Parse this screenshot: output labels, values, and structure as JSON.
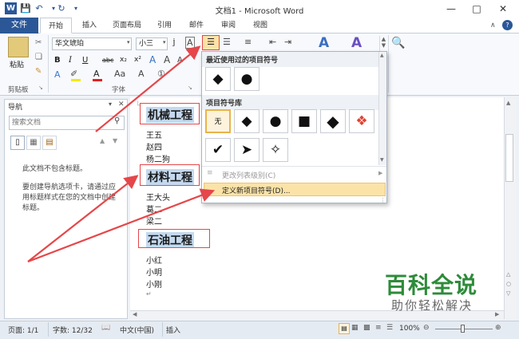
{
  "window": {
    "title": "文档1 - Microsoft Word"
  },
  "tabs": [
    "文件",
    "开始",
    "插入",
    "页面布局",
    "引用",
    "邮件",
    "审阅",
    "视图"
  ],
  "ribbon": {
    "paste_label": "粘贴",
    "clipboard_group": "剪贴板",
    "font_group": "字体",
    "font_name": "华文琥珀",
    "font_size": "小三",
    "char_border": "A",
    "bold": "B",
    "italic": "I",
    "underline": "U",
    "strike": "abc",
    "subscript": "x₂",
    "superscript": "x²",
    "grow_font": "A",
    "shrink_font": "A",
    "styles_a1": "A",
    "styles_a2": "A",
    "find_icon": "☰"
  },
  "nav": {
    "title": "导航",
    "search_placeholder": "搜索文档",
    "no_headings": "此文档不包含标题。",
    "help_text": "要创建导航选项卡，请通过应用标题样式在您的文档中创建标题。"
  },
  "document": {
    "heading1": "机械工程",
    "lines1": [
      "王五",
      "赵四",
      "杨二狗"
    ],
    "heading2": "材料工程",
    "lines2": [
      "王大头",
      "葛二",
      "梁二"
    ],
    "heading3": "石油工程",
    "lines3": [
      "小红",
      "小明",
      "小刚"
    ]
  },
  "bullet_menu": {
    "recent_title": "最近使用过的项目符号",
    "recent": [
      "◆",
      "●"
    ],
    "library_title": "项目符号库",
    "library": [
      "无",
      "◆",
      "●",
      "■",
      "◆",
      "❖",
      "✔",
      "➤",
      "✧"
    ],
    "change_level": "更改列表级别(C)",
    "define_new": "定义新项目符号(D)..."
  },
  "status": {
    "page": "页面: 1/1",
    "words": "字数: 12/32",
    "language": "中文(中国)",
    "insert": "插入",
    "zoom": "100%"
  },
  "watermark": {
    "title": "百科全说",
    "subtitle": "助你轻松解决"
  },
  "colors": {
    "accent": "#2b5797",
    "highlight": "#c4d9ef",
    "annotation": "#e5474a"
  }
}
